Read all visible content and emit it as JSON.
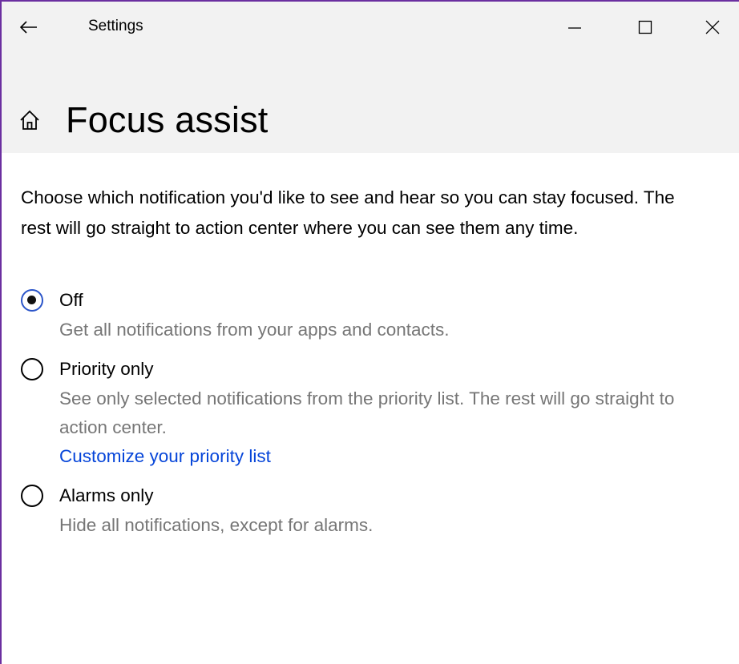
{
  "window": {
    "title": "Settings"
  },
  "page": {
    "title": "Focus assist",
    "description": "Choose which notification you'd like to see and hear so you can stay focused. The rest will go straight to action center where you can see them any time."
  },
  "options": [
    {
      "label": "Off",
      "description": "Get all notifications from your apps and contacts.",
      "checked": true
    },
    {
      "label": "Priority only",
      "description": "See only selected notifications from the priority list. The rest will go straight to action center.",
      "link": "Customize your priority list",
      "checked": false
    },
    {
      "label": "Alarms only",
      "description": "Hide all notifications, except for alarms.",
      "checked": false
    }
  ],
  "icons": {
    "back": "back-arrow-icon",
    "minimize": "minimize-icon",
    "maximize": "maximize-icon",
    "close": "close-icon",
    "home": "home-icon"
  },
  "colors": {
    "accent": "#2b55c9",
    "link": "#0645d9",
    "secondary_text": "#767676",
    "header_background": "#f2f2f2",
    "window_border": "#6b2fa0"
  }
}
